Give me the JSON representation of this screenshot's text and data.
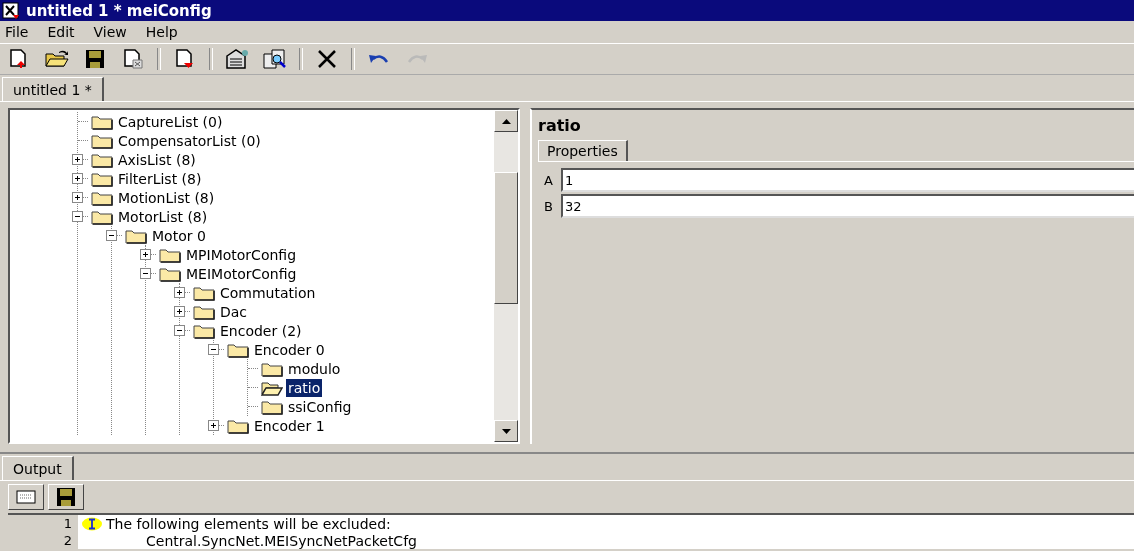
{
  "window": {
    "title": "untitled 1 * meiConfig"
  },
  "menu": [
    "File",
    "Edit",
    "View",
    "Help"
  ],
  "toolbar": [
    {
      "kind": "new",
      "disabled": false
    },
    {
      "kind": "open",
      "disabled": false
    },
    {
      "kind": "save",
      "disabled": false
    },
    {
      "kind": "close",
      "disabled": false
    },
    {
      "kind": "sep"
    },
    {
      "kind": "export",
      "disabled": false
    },
    {
      "kind": "sep"
    },
    {
      "kind": "properties",
      "disabled": false
    },
    {
      "kind": "find",
      "disabled": false
    },
    {
      "kind": "sep"
    },
    {
      "kind": "delete",
      "disabled": false
    },
    {
      "kind": "sep"
    },
    {
      "kind": "undo",
      "disabled": false
    },
    {
      "kind": "redo",
      "disabled": true
    }
  ],
  "document_tabs": [
    {
      "label": "untitled 1 *",
      "selected": true
    }
  ],
  "tree": [
    {
      "label": "CaptureList (0)",
      "selected": false
    },
    {
      "label": "CompensatorList (0)",
      "selected": false
    },
    {
      "label": "AxisList (8)",
      "expanded": false,
      "selected": false
    },
    {
      "label": "FilterList (8)",
      "expanded": false,
      "selected": false
    },
    {
      "label": "MotionList (8)",
      "expanded": false,
      "selected": false
    },
    {
      "label": "MotorList (8)",
      "expanded": true,
      "selected": false,
      "children": [
        {
          "label": "Motor 0",
          "expanded": true,
          "selected": false,
          "children": [
            {
              "label": "MPIMotorConfig",
              "expanded": false,
              "selected": false
            },
            {
              "label": "MEIMotorConfig",
              "expanded": true,
              "selected": false,
              "children": [
                {
                  "label": "Commutation",
                  "expanded": false,
                  "selected": false
                },
                {
                  "label": "Dac",
                  "expanded": false,
                  "selected": false
                },
                {
                  "label": "Encoder (2)",
                  "expanded": true,
                  "selected": false,
                  "children": [
                    {
                      "label": "Encoder 0",
                      "expanded": true,
                      "selected": false,
                      "children": [
                        {
                          "label": "modulo",
                          "selected": false
                        },
                        {
                          "label": "ratio",
                          "selected": true
                        },
                        {
                          "label": "ssiConfig",
                          "selected": false
                        }
                      ]
                    },
                    {
                      "label": "Encoder 1",
                      "expanded": false,
                      "selected": false
                    }
                  ]
                }
              ]
            }
          ]
        }
      ]
    }
  ],
  "details": {
    "title": "ratio",
    "tabs": [
      {
        "label": "Properties",
        "selected": true
      }
    ],
    "fields": [
      {
        "label": "A",
        "value": "1"
      },
      {
        "label": "B",
        "value": "32"
      }
    ]
  },
  "output": {
    "tabs": [
      {
        "label": "Output",
        "selected": true
      }
    ],
    "tools": [
      {
        "kind": "clear"
      },
      {
        "kind": "save"
      }
    ],
    "lines": [
      {
        "number": "1",
        "kind": "info",
        "text": "The following elements will be excluded:"
      },
      {
        "number": "2",
        "kind": "plain",
        "text": "Central.SyncNet.MEISyncNetPacketCfg"
      }
    ]
  }
}
